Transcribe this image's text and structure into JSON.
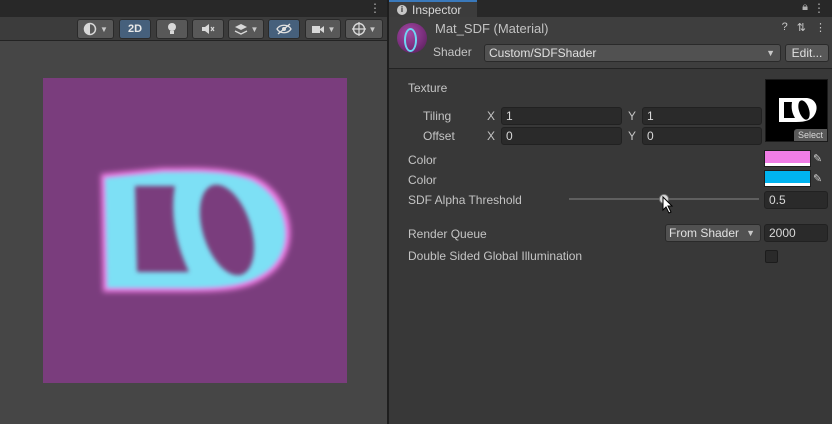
{
  "scene": {
    "toolbar": {
      "shading_icon": "shading-mode-icon",
      "mode_2d_label": "2D",
      "lighting_icon": "lighting-toggle-icon",
      "audio_icon": "audio-mute-icon",
      "effects_icon": "effects-layers-icon",
      "visibility_icon": "hidden-visibility-icon",
      "camera_icon": "camera-icon",
      "gizmos_icon": "gizmos-icon",
      "more_icon": "kebab-menu-icon"
    },
    "preview": {
      "background_color": "#7a3d7d",
      "glyph_fill_color": "#7de0f5",
      "glyph_outline_color": "#f17de6",
      "glyph_text": "DO"
    }
  },
  "inspector": {
    "tab_label": "Inspector",
    "material": {
      "name": "Mat_SDF (Material)",
      "shader_label": "Shader",
      "shader_value": "Custom/SDFShader",
      "edit_label": "Edit..."
    },
    "properties": {
      "texture_label": "Texture",
      "tiling_label": "Tiling",
      "tiling_x": "1",
      "tiling_y": "1",
      "offset_label": "Offset",
      "offset_x": "0",
      "offset_y": "0",
      "axis_x": "X",
      "axis_y": "Y",
      "select_label": "Select",
      "color1_label": "Color",
      "color1_value": "#f17de6",
      "color2_label": "Color",
      "color2_value": "#00b4f0",
      "alpha_label": "SDF Alpha Threshold",
      "alpha_value": "0.5",
      "alpha_fraction": 0.5,
      "render_queue_label": "Render Queue",
      "render_queue_mode": "From Shader",
      "render_queue_value": "2000",
      "double_sided_label": "Double Sided Global Illumination",
      "double_sided_checked": false
    }
  }
}
